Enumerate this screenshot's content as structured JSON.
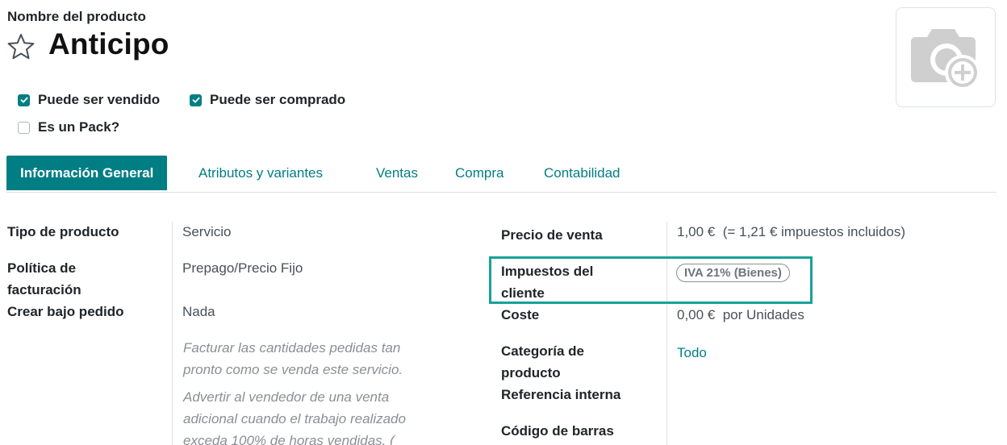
{
  "header": {
    "field_label": "Nombre del producto",
    "product_name": "Anticipo"
  },
  "checkboxes": {
    "can_be_sold": {
      "label": "Puede ser vendido",
      "checked": true
    },
    "can_be_purchased": {
      "label": "Puede ser comprado",
      "checked": true
    },
    "is_pack": {
      "label": "Es un Pack?",
      "checked": false
    }
  },
  "tabs": [
    {
      "label": "Información General",
      "active": true
    },
    {
      "label": "Atributos y variantes",
      "active": false
    },
    {
      "label": "Ventas",
      "active": false
    },
    {
      "label": "Compra",
      "active": false
    },
    {
      "label": "Contabilidad",
      "active": false
    }
  ],
  "left": {
    "product_type": {
      "label": "Tipo de producto",
      "value": "Servicio"
    },
    "invoice_policy": {
      "label_line1": "Política de",
      "label_line2": "facturación",
      "value": "Prepago/Precio Fijo"
    },
    "create_on_order": {
      "label": "Crear bajo pedido",
      "value": "Nada"
    },
    "help1": [
      "Facturar las cantidades pedidas tan",
      "pronto como se venda este servicio."
    ],
    "help2": [
      "Advertir al vendedor de una venta",
      "adicional cuando el trabajo realizado",
      "exceda 100% de horas vendidas. ("
    ]
  },
  "right": {
    "sale_price": {
      "label": "Precio de venta",
      "value": "1,00 €",
      "tax_included": "(= 1,21 € impuestos incluidos)"
    },
    "customer_taxes": {
      "label_line1": "Impuestos del",
      "label_line2": "cliente",
      "badge": "IVA 21% (Bienes)"
    },
    "cost": {
      "label": "Coste",
      "value": "0,00 €",
      "unit": "por Unidades"
    },
    "category": {
      "label_line1": "Categoría de",
      "label_line2": "producto",
      "value": "Todo"
    },
    "internal_ref": {
      "label": "Referencia interna"
    },
    "barcode": {
      "label": "Código de barras"
    }
  },
  "colors": {
    "primary": "#017e84",
    "highlight": "#17a299"
  }
}
